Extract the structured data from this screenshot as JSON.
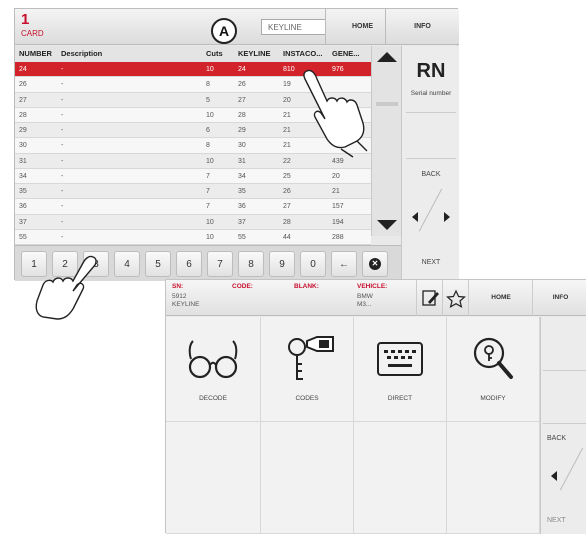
{
  "screen1": {
    "card_number": "1",
    "card_label": "CARD",
    "callout": "A",
    "keyline_field": "KEYLINE",
    "home": "HOME",
    "info": "INFO",
    "columns": [
      "NUMBER",
      "Description",
      "Cuts",
      "KEYLINE",
      "INSTACO...",
      "GENE..."
    ],
    "rows": [
      [
        "24",
        "-",
        "10",
        "24",
        "810",
        "976"
      ],
      [
        "26",
        "-",
        "8",
        "26",
        "19",
        ""
      ],
      [
        "27",
        "-",
        "5",
        "27",
        "20",
        ""
      ],
      [
        "28",
        "-",
        "10",
        "28",
        "21",
        ""
      ],
      [
        "29",
        "-",
        "6",
        "29",
        "21",
        ""
      ],
      [
        "30",
        "-",
        "8",
        "30",
        "21",
        ""
      ],
      [
        "31",
        "-",
        "10",
        "31",
        "22",
        "439"
      ],
      [
        "34",
        "-",
        "7",
        "34",
        "25",
        "20"
      ],
      [
        "35",
        "-",
        "7",
        "35",
        "26",
        "21"
      ],
      [
        "36",
        "-",
        "7",
        "36",
        "27",
        "157"
      ],
      [
        "37",
        "-",
        "10",
        "37",
        "28",
        "194"
      ],
      [
        "55",
        "-",
        "10",
        "55",
        "44",
        "288"
      ]
    ],
    "selected_row": 0,
    "right_title": "RN",
    "right_subtitle": "Serial number",
    "back": "BACK",
    "next": "NEXT",
    "keys": [
      "1",
      "2",
      "3",
      "4",
      "5",
      "6",
      "7",
      "8",
      "9",
      "0",
      "←"
    ],
    "clear_key": "✕"
  },
  "screen2": {
    "sn_label": "SN:",
    "sn_value_1": "5912",
    "sn_value_2": "KEYLINE",
    "code_label": "CODE:",
    "blank_label": "BLANK:",
    "vehicle_label": "VEHICLE:",
    "vehicle_value_1": "BMW",
    "vehicle_value_2": "M3...",
    "home": "HOME",
    "info": "INFO",
    "tiles": [
      "DECODE",
      "CODES",
      "DIRECT",
      "MODIFY"
    ],
    "back": "BACK",
    "next": "NEXT"
  },
  "colors": {
    "accent": "#c8102e",
    "selected_row": "#d2232a"
  }
}
